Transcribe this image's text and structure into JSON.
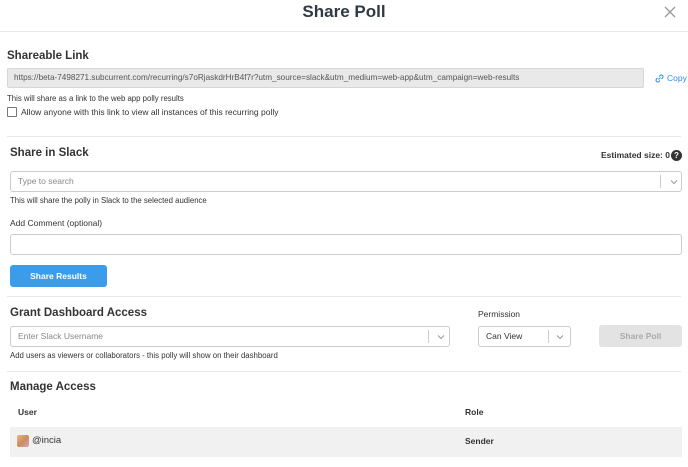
{
  "modal": {
    "title": "Share Poll"
  },
  "shareable_link": {
    "heading": "Shareable Link",
    "url": "https://beta-7498271.subcurrent.com/recurring/s7oRjaskdrHrB4f7r?utm_source=slack&utm_medium=web-app&utm_campaign=web-results",
    "copy_label": "Copy",
    "hint": "This will share as a link to the web app polly results",
    "checkbox_label": "Allow anyone with this link to view all instances of this recurring polly",
    "checkbox_checked": false
  },
  "share_in_slack": {
    "heading": "Share in Slack",
    "estimated_size_label": "Estimated size: 0",
    "search_placeholder": "Type to search",
    "hint": "This will share the polly in Slack to the selected audience",
    "comment_label": "Add Comment (optional)",
    "comment_value": "",
    "share_button": "Share Results"
  },
  "dashboard_access": {
    "heading": "Grant Dashboard Access",
    "username_placeholder": "Enter Slack Username",
    "permission_label": "Permission",
    "permission_value": "Can View",
    "share_poll_button": "Share Poll",
    "hint": "Add users as viewers or collaborators - this polly will show on their dashboard"
  },
  "manage_access": {
    "heading": "Manage Access",
    "columns": {
      "user": "User",
      "role": "Role"
    },
    "rows": [
      {
        "user": "@incia",
        "role": "Sender"
      }
    ]
  },
  "colors": {
    "accent": "#3b9cea",
    "link": "#2d8ce8",
    "disabled": "#e3e3e3"
  }
}
